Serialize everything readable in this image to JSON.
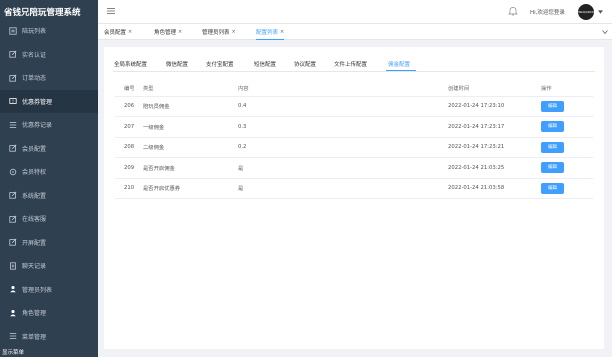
{
  "app": {
    "title": "省钱兄陪玩管理系统"
  },
  "sidebar": {
    "items": [
      {
        "label": "陪玩列表",
        "icon": "list-icon"
      },
      {
        "label": "实名认证",
        "icon": "edit-icon"
      },
      {
        "label": "订单动态",
        "icon": "edit-icon"
      },
      {
        "label": "优惠券管理",
        "icon": "ticket-icon"
      },
      {
        "label": "优惠券记录",
        "icon": "list-icon"
      },
      {
        "label": "会员配置",
        "icon": "edit-icon"
      },
      {
        "label": "会员特权",
        "icon": "gift-icon"
      },
      {
        "label": "系统配置",
        "icon": "edit-icon"
      },
      {
        "label": "在线客服",
        "icon": "edit-icon"
      },
      {
        "label": "开屏配置",
        "icon": "edit-icon"
      },
      {
        "label": "聊天记录",
        "icon": "doc-icon"
      },
      {
        "label": "管理员列表",
        "icon": "user-icon"
      },
      {
        "label": "角色管理",
        "icon": "user-icon"
      },
      {
        "label": "菜单管理",
        "icon": "list-icon"
      }
    ],
    "footer": "显示菜单"
  },
  "header": {
    "welcome": "Hi,欢迎您登录",
    "avatar_text": "SHENGQIANXIONG"
  },
  "tabs": [
    {
      "label": "会员配置",
      "close": "×"
    },
    {
      "label": "角色管理",
      "close": "×"
    },
    {
      "label": "管理员列表",
      "close": "×"
    },
    {
      "label": "配置列表",
      "close": "×"
    }
  ],
  "subtabs": [
    "全局系统配置",
    "微信配置",
    "支付宝配置",
    "短信配置",
    "协议配置",
    "文件上传配置",
    "佣金配置"
  ],
  "table": {
    "headers": [
      "编号",
      "类型",
      "内容",
      "创建时间",
      "操作"
    ],
    "rows": [
      {
        "id": "206",
        "type": "陪玩员佣金",
        "value": "0.4",
        "time": "2022-01-24 17:23:10",
        "action": "编辑"
      },
      {
        "id": "207",
        "type": "一级佣金",
        "value": "0.3",
        "time": "2022-01-24 17:23:17",
        "action": "编辑"
      },
      {
        "id": "208",
        "type": "二级佣金",
        "value": "0.2",
        "time": "2022-01-24 17:23:21",
        "action": "编辑"
      },
      {
        "id": "209",
        "type": "是否开启佣金",
        "value": "是",
        "time": "2022-01-24 21:03:25",
        "action": "编辑"
      },
      {
        "id": "210",
        "type": "是否开启优惠券",
        "value": "是",
        "time": "2022-01-24 21:03:58",
        "action": "编辑"
      }
    ]
  },
  "colors": {
    "sidebar": "#2f4050",
    "accent": "#409eff"
  }
}
